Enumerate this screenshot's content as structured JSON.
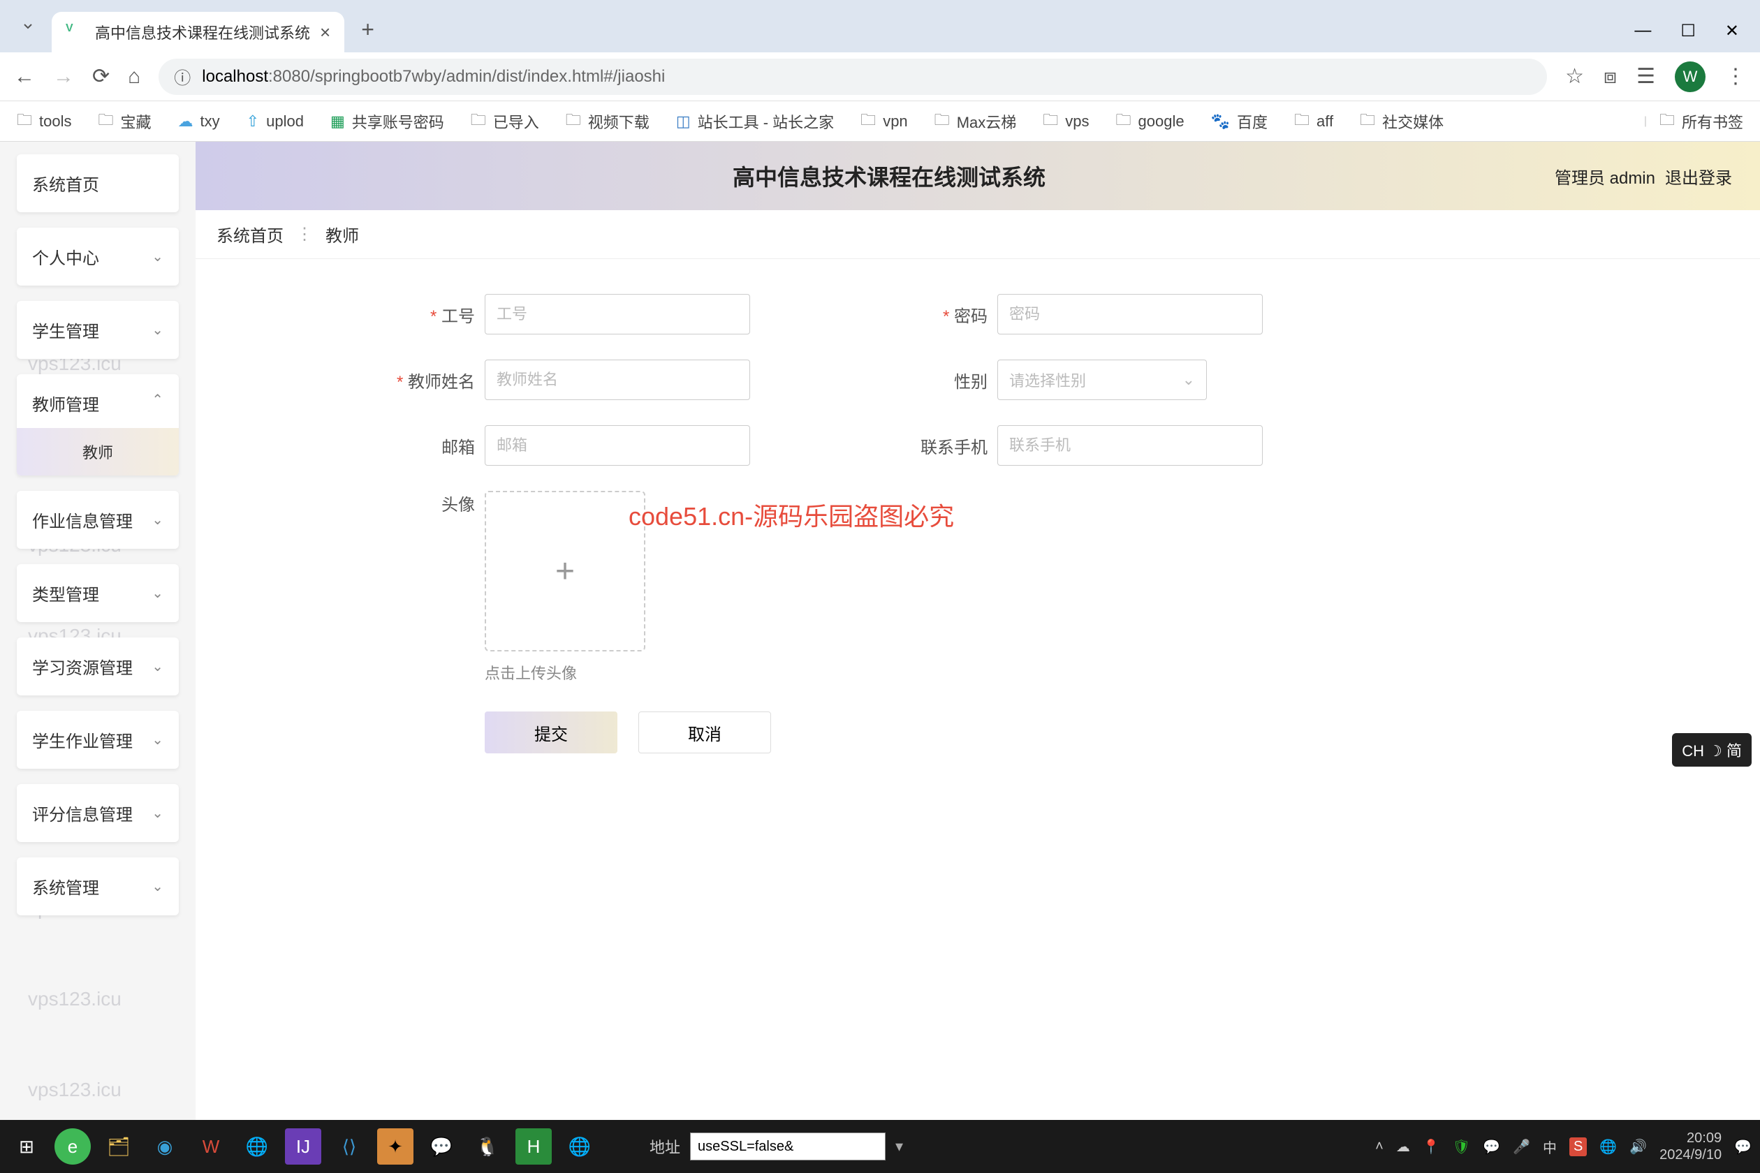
{
  "browser": {
    "tab_title": "高中信息技术课程在线测试系统",
    "url_host": "localhost",
    "url_port": ":8080",
    "url_path": "/springbootb7wby/admin/dist/index.html#/jiaoshi",
    "profile_letter": "W"
  },
  "bookmarks": [
    "tools",
    "宝藏",
    "txy",
    "uplod",
    "共享账号密码",
    "已导入",
    "视频下载",
    "站长工具 - 站长之家",
    "vpn",
    "Max云梯",
    "vps",
    "google",
    "百度",
    "aff",
    "社交媒体"
  ],
  "bookmarks_all": "所有书签",
  "sidebar": {
    "items": [
      {
        "label": "系统首页",
        "expandable": false
      },
      {
        "label": "个人中心",
        "expandable": true
      },
      {
        "label": "学生管理",
        "expandable": true
      },
      {
        "label": "教师管理",
        "expandable": true,
        "active": true,
        "sub": "教师"
      },
      {
        "label": "作业信息管理",
        "expandable": true
      },
      {
        "label": "类型管理",
        "expandable": true
      },
      {
        "label": "学习资源管理",
        "expandable": true
      },
      {
        "label": "学生作业管理",
        "expandable": true
      },
      {
        "label": "评分信息管理",
        "expandable": true
      },
      {
        "label": "系统管理",
        "expandable": true
      }
    ]
  },
  "header": {
    "title": "高中信息技术课程在线测试系统",
    "role": "管理员 admin",
    "logout": "退出登录"
  },
  "breadcrumb": {
    "home": "系统首页",
    "current": "教师"
  },
  "form": {
    "gonghao": {
      "label": "工号",
      "placeholder": "工号"
    },
    "mima": {
      "label": "密码",
      "placeholder": "密码"
    },
    "jiaoshi": {
      "label": "教师姓名",
      "placeholder": "教师姓名"
    },
    "xingbie": {
      "label": "性别",
      "placeholder": "请选择性别"
    },
    "youxiang": {
      "label": "邮箱",
      "placeholder": "邮箱"
    },
    "lianxi": {
      "label": "联系手机",
      "placeholder": "联系手机"
    },
    "touxiang": {
      "label": "头像",
      "hint": "点击上传头像"
    },
    "submit": "提交",
    "cancel": "取消"
  },
  "watermark_text": "vps123.icu",
  "center_wm": "code51.cn-源码乐园盗图必究",
  "ime": "CH ☽ 简",
  "taskbar": {
    "addr_label": "地址",
    "addr_value": "useSSL=false&",
    "time": "20:09",
    "date": "2024/9/10"
  }
}
